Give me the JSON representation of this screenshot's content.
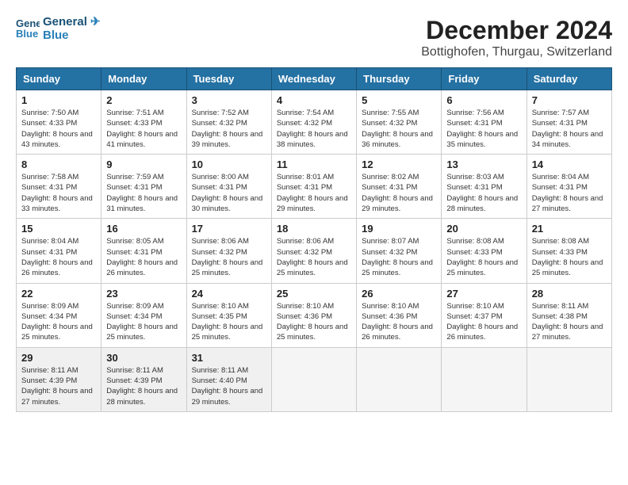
{
  "logo": {
    "line1": "General",
    "line2": "Blue"
  },
  "title": "December 2024",
  "location": "Bottighofen, Thurgau, Switzerland",
  "headers": [
    "Sunday",
    "Monday",
    "Tuesday",
    "Wednesday",
    "Thursday",
    "Friday",
    "Saturday"
  ],
  "weeks": [
    [
      {
        "day": "1",
        "sunrise": "7:50 AM",
        "sunset": "4:33 PM",
        "daylight": "8 hours and 43 minutes."
      },
      {
        "day": "2",
        "sunrise": "7:51 AM",
        "sunset": "4:33 PM",
        "daylight": "8 hours and 41 minutes."
      },
      {
        "day": "3",
        "sunrise": "7:52 AM",
        "sunset": "4:32 PM",
        "daylight": "8 hours and 39 minutes."
      },
      {
        "day": "4",
        "sunrise": "7:54 AM",
        "sunset": "4:32 PM",
        "daylight": "8 hours and 38 minutes."
      },
      {
        "day": "5",
        "sunrise": "7:55 AM",
        "sunset": "4:32 PM",
        "daylight": "8 hours and 36 minutes."
      },
      {
        "day": "6",
        "sunrise": "7:56 AM",
        "sunset": "4:31 PM",
        "daylight": "8 hours and 35 minutes."
      },
      {
        "day": "7",
        "sunrise": "7:57 AM",
        "sunset": "4:31 PM",
        "daylight": "8 hours and 34 minutes."
      }
    ],
    [
      {
        "day": "8",
        "sunrise": "7:58 AM",
        "sunset": "4:31 PM",
        "daylight": "8 hours and 33 minutes."
      },
      {
        "day": "9",
        "sunrise": "7:59 AM",
        "sunset": "4:31 PM",
        "daylight": "8 hours and 31 minutes."
      },
      {
        "day": "10",
        "sunrise": "8:00 AM",
        "sunset": "4:31 PM",
        "daylight": "8 hours and 30 minutes."
      },
      {
        "day": "11",
        "sunrise": "8:01 AM",
        "sunset": "4:31 PM",
        "daylight": "8 hours and 29 minutes."
      },
      {
        "day": "12",
        "sunrise": "8:02 AM",
        "sunset": "4:31 PM",
        "daylight": "8 hours and 29 minutes."
      },
      {
        "day": "13",
        "sunrise": "8:03 AM",
        "sunset": "4:31 PM",
        "daylight": "8 hours and 28 minutes."
      },
      {
        "day": "14",
        "sunrise": "8:04 AM",
        "sunset": "4:31 PM",
        "daylight": "8 hours and 27 minutes."
      }
    ],
    [
      {
        "day": "15",
        "sunrise": "8:04 AM",
        "sunset": "4:31 PM",
        "daylight": "8 hours and 26 minutes."
      },
      {
        "day": "16",
        "sunrise": "8:05 AM",
        "sunset": "4:31 PM",
        "daylight": "8 hours and 26 minutes."
      },
      {
        "day": "17",
        "sunrise": "8:06 AM",
        "sunset": "4:32 PM",
        "daylight": "8 hours and 25 minutes."
      },
      {
        "day": "18",
        "sunrise": "8:06 AM",
        "sunset": "4:32 PM",
        "daylight": "8 hours and 25 minutes."
      },
      {
        "day": "19",
        "sunrise": "8:07 AM",
        "sunset": "4:32 PM",
        "daylight": "8 hours and 25 minutes."
      },
      {
        "day": "20",
        "sunrise": "8:08 AM",
        "sunset": "4:33 PM",
        "daylight": "8 hours and 25 minutes."
      },
      {
        "day": "21",
        "sunrise": "8:08 AM",
        "sunset": "4:33 PM",
        "daylight": "8 hours and 25 minutes."
      }
    ],
    [
      {
        "day": "22",
        "sunrise": "8:09 AM",
        "sunset": "4:34 PM",
        "daylight": "8 hours and 25 minutes."
      },
      {
        "day": "23",
        "sunrise": "8:09 AM",
        "sunset": "4:34 PM",
        "daylight": "8 hours and 25 minutes."
      },
      {
        "day": "24",
        "sunrise": "8:10 AM",
        "sunset": "4:35 PM",
        "daylight": "8 hours and 25 minutes."
      },
      {
        "day": "25",
        "sunrise": "8:10 AM",
        "sunset": "4:36 PM",
        "daylight": "8 hours and 25 minutes."
      },
      {
        "day": "26",
        "sunrise": "8:10 AM",
        "sunset": "4:36 PM",
        "daylight": "8 hours and 26 minutes."
      },
      {
        "day": "27",
        "sunrise": "8:10 AM",
        "sunset": "4:37 PM",
        "daylight": "8 hours and 26 minutes."
      },
      {
        "day": "28",
        "sunrise": "8:11 AM",
        "sunset": "4:38 PM",
        "daylight": "8 hours and 27 minutes."
      }
    ],
    [
      {
        "day": "29",
        "sunrise": "8:11 AM",
        "sunset": "4:39 PM",
        "daylight": "8 hours and 27 minutes."
      },
      {
        "day": "30",
        "sunrise": "8:11 AM",
        "sunset": "4:39 PM",
        "daylight": "8 hours and 28 minutes."
      },
      {
        "day": "31",
        "sunrise": "8:11 AM",
        "sunset": "4:40 PM",
        "daylight": "8 hours and 29 minutes."
      },
      null,
      null,
      null,
      null
    ]
  ],
  "labels": {
    "sunrise": "Sunrise:",
    "sunset": "Sunset:",
    "daylight": "Daylight:"
  }
}
